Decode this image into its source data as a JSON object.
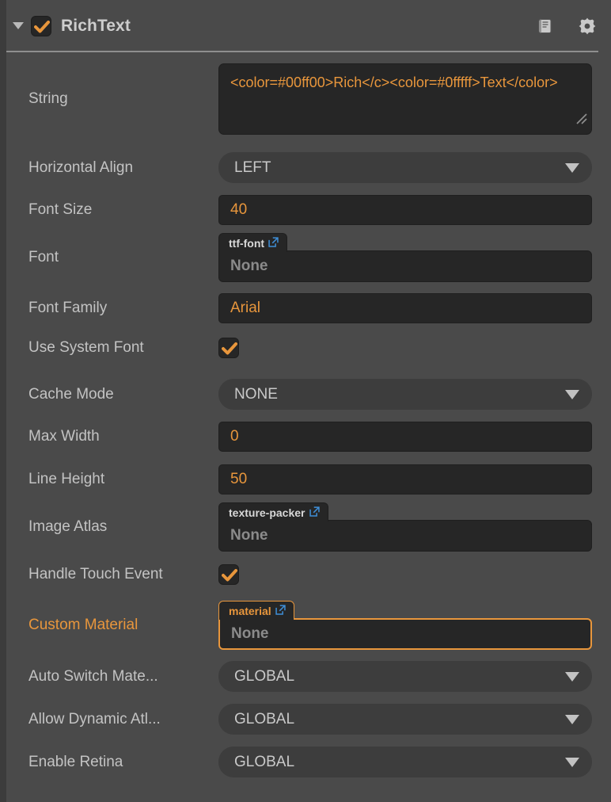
{
  "header": {
    "title": "RichText",
    "enabled": true,
    "fold_icon": "triangle-down-icon",
    "checkbox_icon": "check-icon",
    "help_icon": "book-icon",
    "settings_icon": "gear-icon"
  },
  "colors": {
    "accent": "#e8963c",
    "panel_bg": "#4a4a4a",
    "field_bg": "#262626",
    "dropdown_bg": "#3d3d3d",
    "label": "#c3c3c3",
    "link_icon": "#3f8fd8"
  },
  "properties": [
    {
      "label": "String",
      "type": "textarea",
      "value": "<color=#00ff00>Rich</c><color=#0fffff>Text</color>",
      "resize_handle": "resize-grip-icon"
    },
    {
      "label": "Horizontal Align",
      "type": "dropdown",
      "value": "LEFT",
      "arrow_icon": "chevron-down-icon"
    },
    {
      "label": "Font Size",
      "type": "input",
      "value": "40"
    },
    {
      "label": "Font",
      "type": "asset",
      "badge": "ttf-font",
      "badge_icon": "external-link-icon",
      "value": "None",
      "selected": false
    },
    {
      "label": "Font Family",
      "type": "input",
      "value": "Arial"
    },
    {
      "label": "Use System Font",
      "type": "checkbox",
      "value": true,
      "icon": "check-icon"
    },
    {
      "label": "Cache Mode",
      "type": "dropdown",
      "value": "NONE",
      "arrow_icon": "chevron-down-icon"
    },
    {
      "label": "Max Width",
      "type": "input",
      "value": "0"
    },
    {
      "label": "Line Height",
      "type": "input",
      "value": "50"
    },
    {
      "label": "Image Atlas",
      "type": "asset",
      "badge": "texture-packer",
      "badge_icon": "external-link-icon",
      "value": "None",
      "selected": false
    },
    {
      "label": "Handle Touch Event",
      "type": "checkbox",
      "value": true,
      "icon": "check-icon"
    },
    {
      "label": "Custom Material",
      "type": "asset",
      "badge": "material",
      "badge_icon": "external-link-icon",
      "value": "None",
      "selected": true,
      "label_accent": true
    },
    {
      "label": "Auto Switch Mate...",
      "type": "dropdown",
      "value": "GLOBAL",
      "arrow_icon": "chevron-down-icon"
    },
    {
      "label": "Allow Dynamic Atl...",
      "type": "dropdown",
      "value": "GLOBAL",
      "arrow_icon": "chevron-down-icon"
    },
    {
      "label": "Enable Retina",
      "type": "dropdown",
      "value": "GLOBAL",
      "arrow_icon": "chevron-down-icon"
    }
  ]
}
